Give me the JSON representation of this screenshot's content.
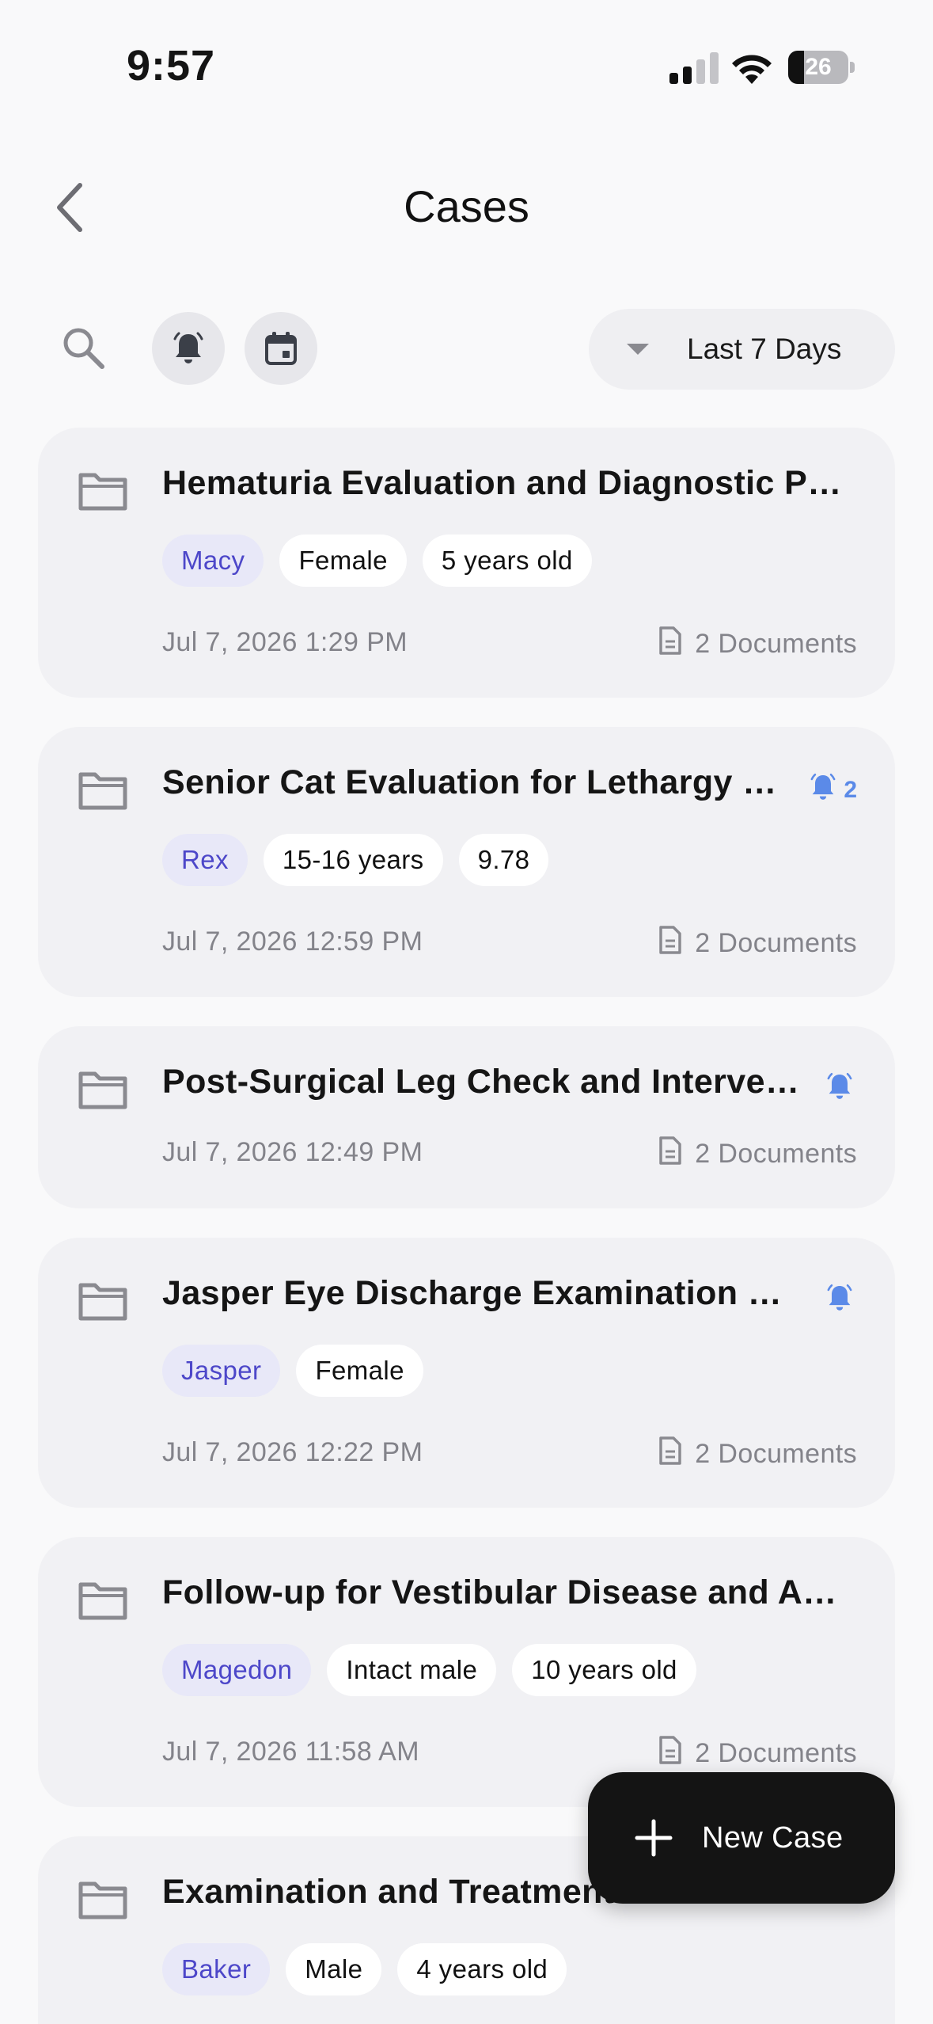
{
  "status_bar": {
    "time": "9:57",
    "battery": "26",
    "battery_level": 0.26
  },
  "header": {
    "title": "Cases"
  },
  "toolbar": {
    "range_label": "Last 7 Days"
  },
  "cases": [
    {
      "title": "Hematuria Evaluation and Diagnostic Plan",
      "tags": [
        {
          "text": "Macy",
          "pet": true
        },
        {
          "text": "Female",
          "pet": false
        },
        {
          "text": "5 years old",
          "pet": false
        }
      ],
      "date": "Jul 7, 2026 1:29 PM",
      "documents": "2 Documents",
      "alert": false,
      "alert_count": ""
    },
    {
      "title": "Senior Cat Evaluation for Lethargy and Weight Loss",
      "tags": [
        {
          "text": "Rex",
          "pet": true
        },
        {
          "text": "15-16 years",
          "pet": false
        },
        {
          "text": "9.78",
          "pet": false
        }
      ],
      "date": "Jul 7, 2026 12:59 PM",
      "documents": "2 Documents",
      "alert": true,
      "alert_count": "2"
    },
    {
      "title": "Post-Surgical Leg Check and Intervention",
      "tags": [],
      "date": "Jul 7, 2026 12:49 PM",
      "documents": "2 Documents",
      "alert": true,
      "alert_count": ""
    },
    {
      "title": "Jasper Eye Discharge Examination and Treatment",
      "tags": [
        {
          "text": "Jasper",
          "pet": true
        },
        {
          "text": "Female",
          "pet": false
        }
      ],
      "date": "Jul 7, 2026 12:22 PM",
      "documents": "2 Documents",
      "alert": true,
      "alert_count": ""
    },
    {
      "title": "Follow-up for Vestibular Disease and Appetite",
      "tags": [
        {
          "text": "Magedon",
          "pet": true
        },
        {
          "text": "Intact male",
          "pet": false
        },
        {
          "text": "10 years old",
          "pet": false
        }
      ],
      "date": "Jul 7, 2026 11:58 AM",
      "documents": "2 Documents",
      "alert": false,
      "alert_count": ""
    },
    {
      "title": "Examination and Treatment of Feline Illness",
      "tags": [
        {
          "text": "Baker",
          "pet": true
        },
        {
          "text": "Male",
          "pet": false
        },
        {
          "text": "4 years old",
          "pet": false
        }
      ],
      "date": "",
      "documents": "",
      "alert": false,
      "alert_count": ""
    }
  ],
  "fab": {
    "label": "New Case"
  },
  "colors": {
    "accent": "#5b8ae8",
    "pet_tag_text": "#4d47c9",
    "pet_tag_bg": "#e8e8f8",
    "card_bg": "#f1f1f4",
    "fab_bg": "#141414"
  }
}
